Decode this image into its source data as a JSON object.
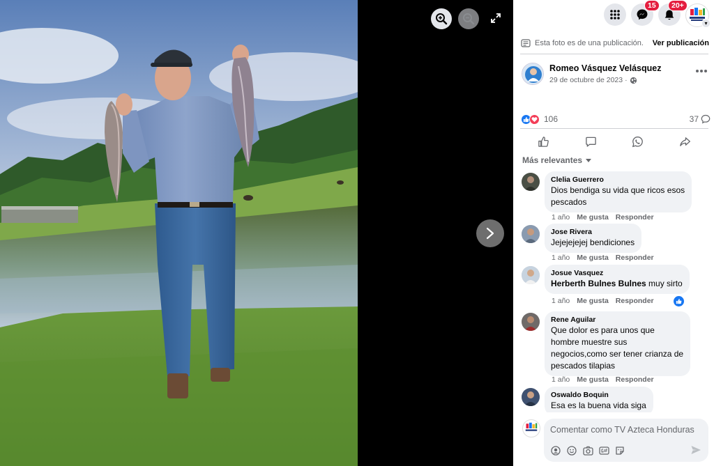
{
  "viewer": {
    "icons": {
      "zoom_in": "zoom-in-icon",
      "zoom_out": "zoom-out-icon",
      "fullscreen": "fullscreen-icon",
      "next": "chevron-right-icon"
    }
  },
  "topbar": {
    "messenger_badge": "15",
    "notifications_badge": "20+",
    "icons": {
      "menu": "grid-menu-icon",
      "messenger": "messenger-icon",
      "notifications": "bell-icon"
    }
  },
  "notice": {
    "text": "Esta foto es de una publicación.",
    "link": "Ver publicación"
  },
  "post": {
    "author": "Romeo Vásquez Velásquez",
    "date": "29 de octubre de 2023",
    "date_separator": "·",
    "audience_icon": "globe-icon",
    "reaction_count": "106",
    "comment_count": "37",
    "colors": {
      "like": "#1877f2",
      "love": "#f33e58"
    }
  },
  "actions": {
    "icons": [
      "like-icon",
      "comment-icon",
      "whatsapp-icon",
      "share-icon"
    ]
  },
  "comments_section": {
    "sort_label": "Más relevantes",
    "items": [
      {
        "name": "Clelia Guerrero",
        "lines": [
          "Dios bendiga su vida que ricos esos",
          "pescados"
        ],
        "time": "1 año",
        "like": "Me gusta",
        "reply": "Responder"
      },
      {
        "name": "Jose Rivera",
        "lines": [
          "Jejejejejej bendiciones"
        ],
        "time": "1 año",
        "like": "Me gusta",
        "reply": "Responder"
      },
      {
        "name": "Josue Vasquez",
        "mention": "Herberth Bulnes Bulnes",
        "text_after_mention": " muy sirto",
        "time": "1 año",
        "like": "Me gusta",
        "reply": "Responder"
      },
      {
        "name": "Rene Aguilar",
        "lines": [
          "Que dolor es para unos que",
          "hombre muestre sus",
          "negocios,como ser tener crianza de",
          "pescados tilapias"
        ],
        "time": "1 año",
        "like": "Me gusta",
        "reply": "Responder"
      },
      {
        "name": "Oswaldo Boquin",
        "lines": [
          "Esa es la buena vida siga"
        ]
      }
    ]
  },
  "composer": {
    "placeholder": "Comentar como TV Azteca Honduras",
    "tools": [
      "avatar-sticker-icon",
      "emoji-icon",
      "camera-icon",
      "gif-icon",
      "sticker-icon"
    ],
    "send_icon": "send-icon"
  }
}
